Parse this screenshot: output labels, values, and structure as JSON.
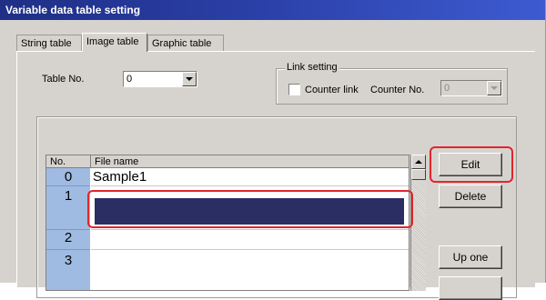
{
  "window": {
    "title": "Variable data table setting"
  },
  "tabs": [
    {
      "label": "String table",
      "active": false
    },
    {
      "label": "Image table",
      "active": true
    },
    {
      "label": "Graphic table",
      "active": false
    }
  ],
  "table_no": {
    "label": "Table No.",
    "value": "0"
  },
  "link_setting": {
    "title": "Link setting",
    "counter_link_label": "Counter link",
    "counter_link_checked": false,
    "counter_no_label": "Counter No.",
    "counter_no_value": "0"
  },
  "table": {
    "headers": {
      "no": "No.",
      "file_name": "File name"
    },
    "rows": [
      {
        "no": "0",
        "file_name": "Sample1",
        "selected": false
      },
      {
        "no": "1",
        "file_name": "",
        "selected": true
      },
      {
        "no": "2",
        "file_name": "",
        "selected": false
      },
      {
        "no": "3",
        "file_name": "",
        "selected": false
      }
    ]
  },
  "buttons": {
    "edit": "Edit",
    "delete": "Delete",
    "up_one": "Up one"
  },
  "colors": {
    "selection": "#2b2e63",
    "highlight": "#e0262d",
    "number_cell": "#9fbbe1"
  }
}
